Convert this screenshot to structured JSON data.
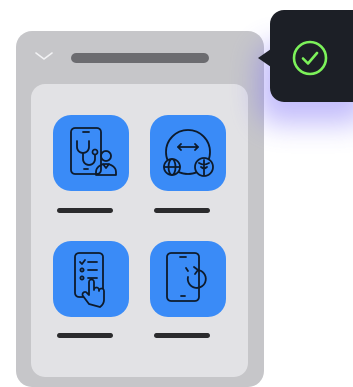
{
  "window": {
    "title": "",
    "background_color": "#c6c6c9"
  },
  "apps": [
    {
      "name": "telehealth-app",
      "icon": "tablet-stethoscope-doctor-icon",
      "label": ""
    },
    {
      "name": "global-medical-app",
      "icon": "globe-caduceus-exchange-icon",
      "label": ""
    },
    {
      "name": "checklist-app",
      "icon": "touch-checklist-icon",
      "label": ""
    },
    {
      "name": "sync-app",
      "icon": "tablet-refresh-icon",
      "label": ""
    }
  ],
  "notification": {
    "status": "success",
    "icon": "check-circle-icon",
    "accent_color": "#7cf25a"
  },
  "colors": {
    "app_icon_background": "#3a8bf7",
    "toast_background": "#1c1f26",
    "glow": "#7a6cf6"
  }
}
